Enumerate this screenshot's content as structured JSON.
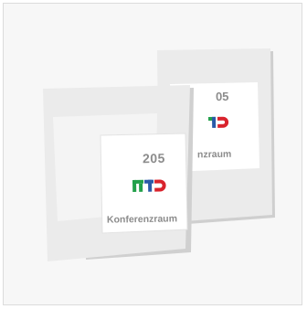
{
  "signs": [
    {
      "id": "front",
      "room_number": "205",
      "room_name": "Konferenzraum",
      "logo": "LTD"
    },
    {
      "id": "back",
      "room_number": "05",
      "room_name": "nzraum",
      "logo": "LTD"
    }
  ],
  "colors": {
    "background": "#f7f7f7",
    "plate": "#e9e9e9",
    "plate_edge": "#d3d3d3",
    "insert": "#ffffff",
    "text": "#8c8c8c",
    "logo_green": "#22a04a",
    "logo_blue": "#2a5aa8",
    "logo_red": "#d9232d"
  }
}
